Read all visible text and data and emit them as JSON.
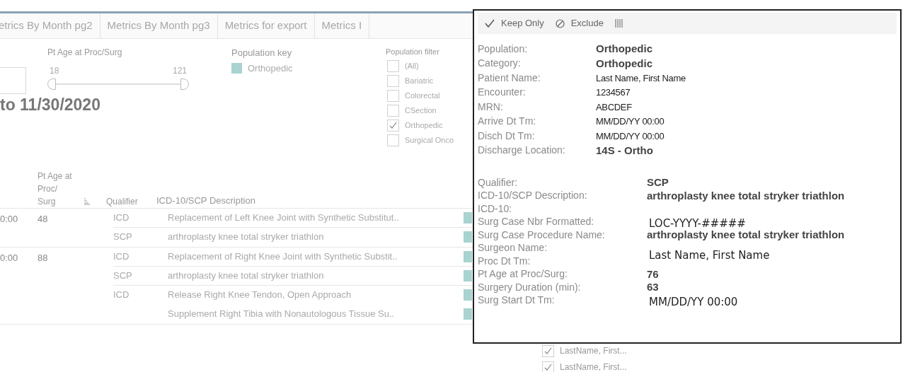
{
  "tabs": [
    {
      "label": "etrics By Month pg2",
      "selected": false
    },
    {
      "label": "Metrics By Month pg3",
      "selected": false
    },
    {
      "label": "Metrics for export",
      "selected": false
    },
    {
      "label": "Metrics I",
      "selected": false
    }
  ],
  "age_filter": {
    "title": "Pt  Age at Proc/Surg",
    "min": "18",
    "max": "121"
  },
  "population_key": {
    "title": "Population key",
    "items": [
      {
        "label": "Orthopedic",
        "color": "#a8d3d0"
      }
    ]
  },
  "population_filter": {
    "title": "Population filter",
    "items": [
      {
        "label": "(All)",
        "checked": false
      },
      {
        "label": "Bariatric",
        "checked": false
      },
      {
        "label": "Colorectal",
        "checked": false
      },
      {
        "label": "CSection",
        "checked": false
      },
      {
        "label": "Orthopedic",
        "checked": true
      },
      {
        "label": "Surgical Onco",
        "checked": false
      }
    ]
  },
  "date_title": "to 11/30/2020",
  "table": {
    "columns": [
      "Pt Age at Proc/ Surg",
      "Qualifier",
      "ICD-10/SCP Description"
    ],
    "groups": [
      {
        "time": "0:00",
        "age": "48",
        "entries": [
          {
            "qualifier": "ICD",
            "description": "Replacement of Left Knee Joint with Synthetic Substitut.."
          },
          {
            "qualifier": "SCP",
            "description": "arthroplasty knee total stryker triathlon"
          }
        ]
      },
      {
        "time": "0:00",
        "age": "88",
        "entries": [
          {
            "qualifier": "ICD",
            "description": "Replacement of Right Knee Joint with Synthetic Substit.."
          },
          {
            "qualifier": "SCP",
            "description": "arthroplasty knee total stryker triathlon"
          },
          {
            "qualifier": "ICD",
            "description": "Release Right Knee Tendon, Open Approach"
          },
          {
            "description": "Supplement Right Tibia with Nonautologous Tissue Su.."
          }
        ]
      }
    ]
  },
  "name_filter": {
    "items": [
      {
        "label": "LastName, First...",
        "checked": true
      },
      {
        "label": "LastName, First...",
        "checked": true
      }
    ]
  },
  "tooltip": {
    "actions": [
      {
        "kind": "keep",
        "label": "Keep Only"
      },
      {
        "kind": "exclude",
        "label": "Exclude"
      },
      {
        "kind": "columns"
      }
    ],
    "sections": [
      [
        {
          "label": "Population:",
          "value": "Orthopedic",
          "kind": "bold"
        },
        {
          "label": "Category:",
          "value": "Orthopedic",
          "kind": "bold"
        },
        {
          "label": "Patient Name:",
          "value": "Last Name, First Name",
          "kind": "plain"
        },
        {
          "label": "Encounter:",
          "value": "1234567",
          "kind": "plain"
        },
        {
          "label": "MRN:",
          "value": "ABCDEF",
          "kind": "plain"
        },
        {
          "label": "Arrive Dt Tm:",
          "value": "MM/DD/YY 00:00",
          "kind": "plain"
        },
        {
          "label": "Disch Dt Tm:",
          "value": "MM/DD/YY 00:00",
          "kind": "plain"
        },
        {
          "label": "Discharge Location:",
          "value": "14S - Ortho",
          "kind": "bold"
        }
      ],
      [
        {
          "label": "Qualifier:",
          "value": "SCP",
          "kind": "bold"
        },
        {
          "label": "ICD-10/SCP Description:",
          "value": "arthroplasty knee total stryker triathlon",
          "kind": "bold"
        },
        {
          "label": "ICD-10:"
        },
        {
          "label": "Surg Case Nbr Formatted:",
          "value": "LOC-YYYY-#####",
          "kind": "large"
        },
        {
          "label": "Surg Case Procedure Name:",
          "value": "arthroplasty knee total stryker triathlon",
          "kind": "bold"
        },
        {
          "label": "Surgeon Name:",
          "value": "Last Name, First Name",
          "kind": "large"
        },
        {
          "label": "Proc Dt Tm:"
        },
        {
          "label": "Pt Age at Proc/Surg:",
          "value": "76",
          "kind": "bold"
        },
        {
          "label": "Surgery Duration (min):",
          "value": "63",
          "kind": "bold"
        },
        {
          "label": "Surg Start Dt Tm:",
          "value": "MM/DD/YY 00:00",
          "kind": "large"
        }
      ]
    ]
  }
}
